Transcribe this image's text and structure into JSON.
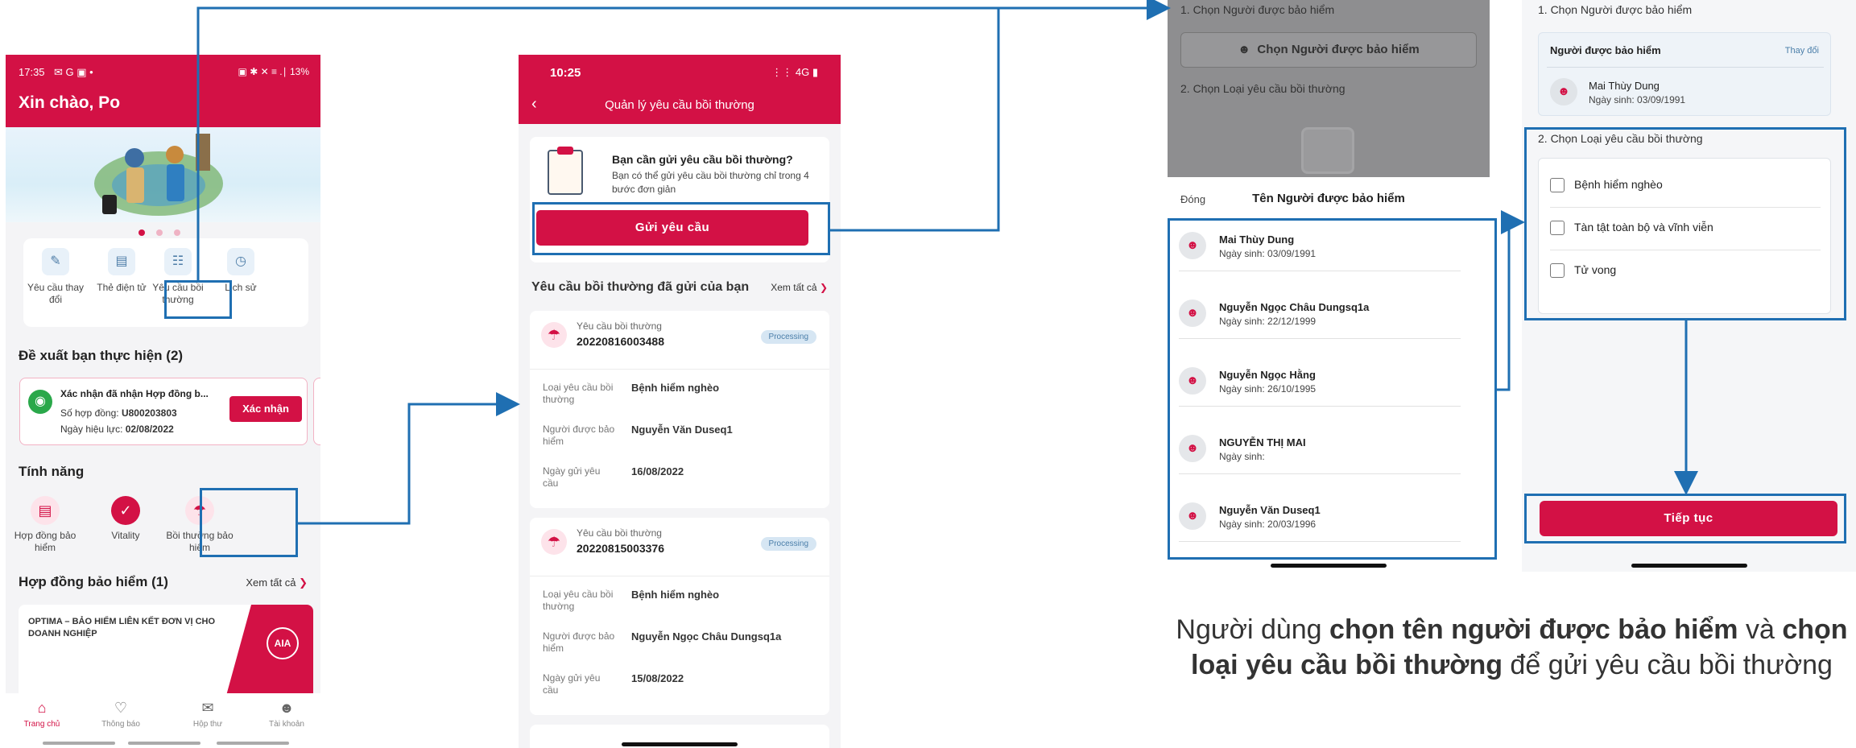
{
  "screen1": {
    "status_time": "17:35",
    "status_icons": "✉ G ▣ •",
    "status_right": "▣ ✱ ✕ ≡ .∣ 13%",
    "greeting": "Xin chào, Po",
    "quick_actions": [
      {
        "label": "Yêu cầu thay đổi",
        "icon": "edit-doc-icon"
      },
      {
        "label": "Thẻ điện tử",
        "icon": "card-icon"
      },
      {
        "label": "Yêu cầu bồi thường",
        "icon": "claim-doc-icon"
      },
      {
        "label": "Lịch sử",
        "icon": "history-icon"
      }
    ],
    "suggest_title": "Đề xuất bạn thực hiện (2)",
    "suggest": {
      "title": "Xác nhận đã nhận Hợp đồng b...",
      "contract_label": "Số hợp đồng:",
      "contract_no": "U800203803",
      "date_label": "Ngày hiệu lực:",
      "date": "02/08/2022",
      "button": "Xác nhận"
    },
    "features_title": "Tính năng",
    "features": [
      {
        "label": "Hợp đồng bảo hiểm",
        "icon": "contract-icon"
      },
      {
        "label": "Vitality",
        "icon": "vitality-icon"
      },
      {
        "label": "Bồi thường bảo hiểm",
        "icon": "umbrella-icon"
      }
    ],
    "contracts_title": "Hợp đồng bảo hiểm (1)",
    "view_all": "Xem tất cả",
    "contract_name": "OPTIMA – BẢO HIỂM LIÊN KẾT ĐƠN VỊ CHO DOANH NGHIỆP",
    "tabs": [
      {
        "label": "Trang chủ",
        "icon": "home-icon"
      },
      {
        "label": "Thông báo",
        "icon": "bell-icon"
      },
      {
        "label": "Hộp thư",
        "icon": "mail-icon"
      },
      {
        "label": "Tài khoản",
        "icon": "user-icon"
      }
    ]
  },
  "screen2": {
    "time": "10:25",
    "signal": "4G",
    "title": "Quản lý yêu cầu bồi thường",
    "intro_title": "Bạn cần gửi yêu cầu bồi thường?",
    "intro_desc": "Bạn có thể gửi yêu cầu bồi thường chỉ trong 4 bước đơn giản",
    "send_button": "Gửi yêu cầu",
    "sent_title": "Yêu cầu bồi thường đã gửi của bạn",
    "view_all": "Xem tất cả",
    "field_labels": {
      "type": "Loại yêu cầu bồi thường",
      "insured": "Người được bảo hiểm",
      "date": "Ngày gửi yêu cầu"
    },
    "claims": [
      {
        "label": "Yêu cầu bồi thường",
        "number": "20220816003488",
        "status": "Processing",
        "type": "Bệnh hiểm nghèo",
        "insured": "Nguyễn Văn Duseq1",
        "date": "16/08/2022"
      },
      {
        "label": "Yêu cầu bồi thường",
        "number": "20220815003376",
        "status": "Processing",
        "type": "Bệnh hiểm nghèo",
        "insured": "Nguyễn Ngọc Châu Dungsq1a",
        "date": "15/08/2022"
      }
    ]
  },
  "screen3": {
    "step1": "1. Chọn Người được bảo hiểm",
    "pick_button": "Chọn Người được bảo hiểm",
    "step2": "2. Chọn Loại yêu cầu bồi thường",
    "close": "Đóng",
    "sheet_title": "Tên Người được bảo hiểm",
    "people": [
      {
        "name": "Mai Thùy Dung",
        "dob": "Ngày sinh: 03/09/1991"
      },
      {
        "name": "Nguyễn Ngọc Châu Dungsq1a",
        "dob": "Ngày sinh: 22/12/1999"
      },
      {
        "name": "Nguyễn Ngọc Hằng",
        "dob": "Ngày sinh: 26/10/1995"
      },
      {
        "name": "NGUYỄN THỊ MAI",
        "dob": "Ngày sinh:"
      },
      {
        "name": "Nguyễn Văn Duseq1",
        "dob": "Ngày sinh: 20/03/1996"
      }
    ]
  },
  "screen4": {
    "step1": "1. Chọn Người được bảo hiểm",
    "card_title": "Người được bảo hiểm",
    "change": "Thay đổi",
    "name": "Mai Thùy Dung",
    "dob": "Ngày sinh: 03/09/1991",
    "step2": "2. Chọn Loại yêu cầu bồi thường",
    "options": [
      "Bệnh hiểm nghèo",
      "Tàn tật toàn bộ và vĩnh viễn",
      "Tử vong"
    ],
    "continue": "Tiếp tục"
  },
  "caption": {
    "p1": "Người dùng ",
    "b1": "chọn tên người được bảo hiểm",
    "p2": " và ",
    "b2": "chọn loại yêu cầu bồi thường",
    "p3": " để gửi yêu cầu bồi thường"
  },
  "colors": {
    "brand": "#d31145",
    "annotation": "#1f6fb2"
  }
}
